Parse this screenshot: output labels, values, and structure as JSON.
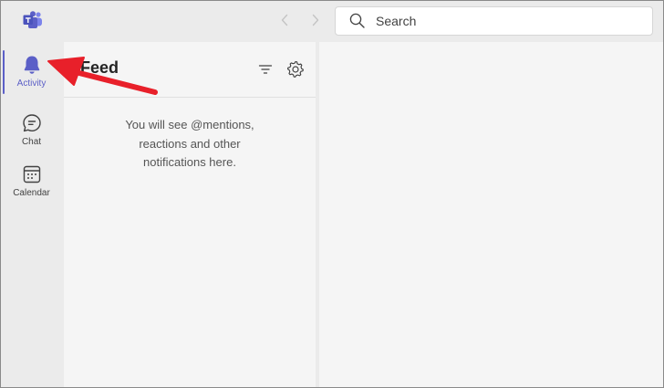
{
  "titlebar": {
    "search_placeholder": "Search",
    "logo_icon": "teams-logo-icon",
    "back_icon": "chevron-left-icon",
    "forward_icon": "chevron-right-icon"
  },
  "rail": {
    "items": [
      {
        "label": "Activity",
        "icon": "bell-icon",
        "active": true
      },
      {
        "label": "Chat",
        "icon": "chat-icon",
        "active": false
      },
      {
        "label": "Calendar",
        "icon": "calendar-icon",
        "active": false
      }
    ]
  },
  "feed": {
    "title": "Feed",
    "empty_message_lines": [
      "You will see @mentions,",
      "reactions and other",
      "notifications here."
    ],
    "filter_icon": "filter-icon",
    "settings_icon": "gear-icon"
  },
  "colors": {
    "accent": "#5b5fc7",
    "annotation_arrow": "#e8202a",
    "rail_background": "#ebebeb",
    "pane_background": "#f5f5f5"
  }
}
